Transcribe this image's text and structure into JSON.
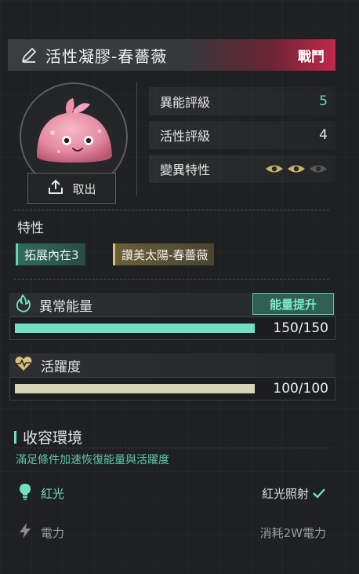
{
  "title": {
    "name": "活性凝膠-春薔薇",
    "tag": "戰鬥"
  },
  "take_button": {
    "label": "取出"
  },
  "stats": [
    {
      "label": "異能評級",
      "value": "5",
      "color": "#5fe0c4"
    },
    {
      "label": "活性評級",
      "value": "4",
      "color": "#e6e6e6"
    },
    {
      "label": "變異特性",
      "value": "",
      "color": "#e6e6e6"
    }
  ],
  "mutation_eyes": {
    "active": 2,
    "total": 3,
    "active_color": "#c8b46a",
    "inactive_color": "#5a5a5a"
  },
  "traits": {
    "heading": "特性",
    "items": [
      {
        "label": "拓展內在3",
        "style": "teal"
      },
      {
        "label": "讚美太陽-春薔薇",
        "style": "gold"
      }
    ]
  },
  "energy": {
    "label": "異常能量",
    "boost_label": "能量提升",
    "value_text": "150/150",
    "fraction": 1.0,
    "color": "#6fe0c4"
  },
  "vitality": {
    "label": "活躍度",
    "value_text": "100/100",
    "fraction": 1.0,
    "color": "#d9d5b4"
  },
  "environment": {
    "title": "收容環境",
    "subtitle": "滿足條件加速恢復能量與活躍度",
    "rows": [
      {
        "name": "紅光",
        "status": "紅光照射",
        "satisfied": true,
        "name_color": "#6fe0c4",
        "status_color": "#e0e0e0"
      },
      {
        "name": "電力",
        "status": "消耗2W電力",
        "satisfied": false,
        "name_color": "#9a9a9a",
        "status_color": "#9a9a9a"
      }
    ]
  },
  "colors": {
    "accent_teal": "#6fe0c4",
    "accent_red": "#c2284a",
    "accent_gold": "#d8c27a"
  }
}
